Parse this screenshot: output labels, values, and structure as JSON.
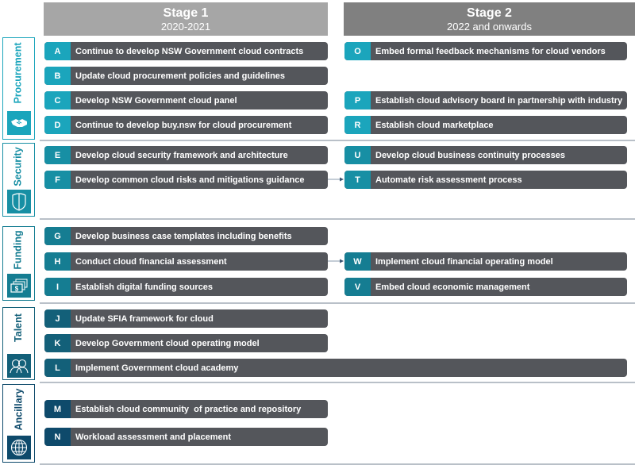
{
  "stages": [
    {
      "title": "Stage 1",
      "subtitle": "2020-2021"
    },
    {
      "title": "Stage 2",
      "subtitle": "2022 and onwards"
    }
  ],
  "colors": {
    "stage1_header": "#a6a6a6",
    "stage2_header": "#808080",
    "pill_body": "#54565b",
    "procurement": "#1ba5bc",
    "security": "#178fa4",
    "funding": "#157d92",
    "talent": "#136079",
    "ancillary": "#0e4a6b",
    "divider": "#b9c0c8"
  },
  "categories": [
    {
      "name": "Procurement",
      "icon": "handshake-icon",
      "items": [
        {
          "id": "A",
          "text": "Continue to develop NSW Government cloud contracts",
          "stage": 1
        },
        {
          "id": "B",
          "text": "Update cloud procurement policies and guidelines",
          "stage": 1
        },
        {
          "id": "C",
          "text": "Develop NSW Government cloud panel",
          "stage": 1
        },
        {
          "id": "D",
          "text": "Continue to develop buy.nsw for cloud procurement",
          "stage": 1
        },
        {
          "id": "O",
          "text": "Embed formal feedback mechanisms for cloud vendors",
          "stage": 2
        },
        {
          "id": "P",
          "text": "Establish cloud advisory board in partnership with industry",
          "stage": 2
        },
        {
          "id": "R",
          "text": "Establish cloud marketplace",
          "stage": 2
        }
      ]
    },
    {
      "name": "Security",
      "icon": "shield-icon",
      "items": [
        {
          "id": "E",
          "text": "Develop cloud security framework and architecture",
          "stage": 1
        },
        {
          "id": "F",
          "text": "Develop common cloud risks and mitigations guidance",
          "stage": 1
        },
        {
          "id": "U",
          "text": "Develop cloud business continuity processes",
          "stage": 2
        },
        {
          "id": "T",
          "text": "Automate risk assessment process",
          "stage": 2
        }
      ]
    },
    {
      "name": "Funding",
      "icon": "money-icon",
      "items": [
        {
          "id": "G",
          "text": "Develop business case templates including benefits",
          "stage": 1
        },
        {
          "id": "H",
          "text": "Conduct cloud financial assessment",
          "stage": 1
        },
        {
          "id": "I",
          "text": "Establish digital funding sources",
          "stage": 1
        },
        {
          "id": "W",
          "text": "Implement cloud financial operating model",
          "stage": 2
        },
        {
          "id": "V",
          "text": "Embed cloud economic management",
          "stage": 2
        }
      ]
    },
    {
      "name": "Talent",
      "icon": "people-icon",
      "items": [
        {
          "id": "J",
          "text": "Update SFIA framework for cloud",
          "stage": 1
        },
        {
          "id": "K",
          "text": "Develop Government cloud operating model",
          "stage": 1
        },
        {
          "id": "L",
          "text": "Implement Government cloud academy",
          "stage": "1-2"
        }
      ]
    },
    {
      "name": "Ancillary",
      "icon": "globe-icon",
      "items": [
        {
          "id": "M",
          "text": "Establish cloud community  of practice and repository",
          "stage": 1
        },
        {
          "id": "N",
          "text": "Workload assessment and placement",
          "stage": 1
        }
      ]
    }
  ],
  "connections": [
    {
      "from": "F",
      "to": "T"
    },
    {
      "from": "H",
      "to": "W"
    }
  ]
}
